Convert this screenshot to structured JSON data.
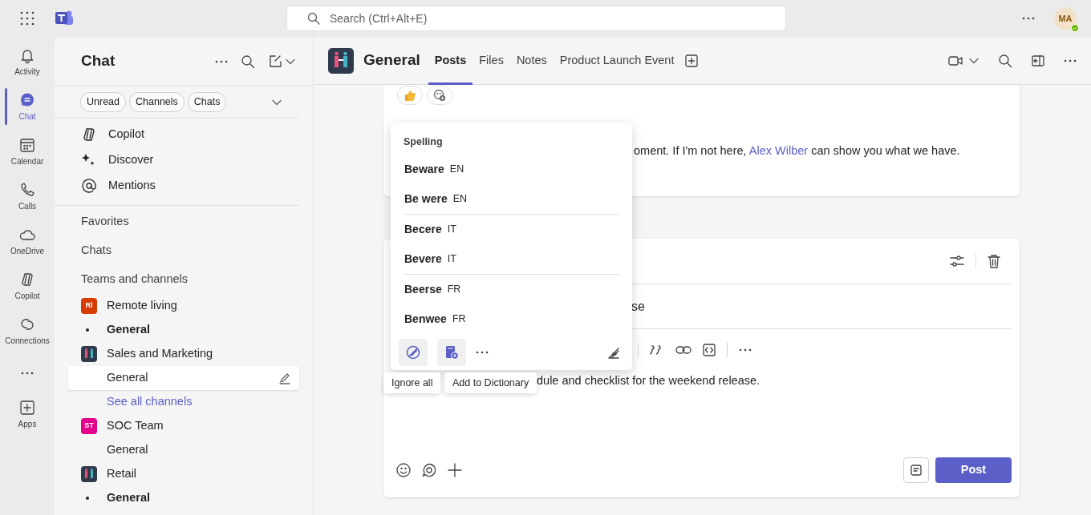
{
  "top_bar": {
    "search_placeholder": "Search (Ctrl+Alt+E)",
    "avatar_initials": "MA"
  },
  "rail": [
    {
      "label": "Activity",
      "selected": false
    },
    {
      "label": "Chat",
      "selected": true
    },
    {
      "label": "Calendar",
      "selected": false
    },
    {
      "label": "Calls",
      "selected": false
    },
    {
      "label": "OneDrive",
      "selected": false
    },
    {
      "label": "Copilot",
      "selected": false
    },
    {
      "label": "Connections",
      "selected": false
    }
  ],
  "rail_apps": {
    "label": "Apps"
  },
  "chat_panel": {
    "title": "Chat",
    "filters": [
      "Unread",
      "Channels",
      "Chats"
    ],
    "shortcuts": [
      "Copilot",
      "Discover",
      "Mentions"
    ],
    "sections": [
      "Favorites",
      "Chats",
      "Teams and channels"
    ],
    "teams": [
      {
        "name": "Remote living",
        "kind": "initials",
        "initials": "Rl",
        "color": "#d83b01",
        "channels": [
          {
            "name": "General",
            "unread": true,
            "selected": false
          }
        ]
      },
      {
        "name": "Sales and Marketing",
        "kind": "picture",
        "channels": [
          {
            "name": "General",
            "unread": false,
            "selected": true
          }
        ],
        "see_all": "See all channels"
      },
      {
        "name": "SOC Team",
        "kind": "initials",
        "initials": "ST",
        "color": "#e3008c",
        "channels": [
          {
            "name": "General",
            "unread": false,
            "selected": false
          }
        ]
      },
      {
        "name": "Retail",
        "kind": "picture",
        "channels": [
          {
            "name": "General",
            "unread": true,
            "selected": false
          }
        ]
      }
    ]
  },
  "channel_header": {
    "title": "General",
    "tabs": [
      {
        "label": "Posts",
        "selected": true
      },
      {
        "label": "Files",
        "selected": false
      },
      {
        "label": "Notes",
        "selected": false
      },
      {
        "label": "Product Launch Event",
        "selected": false
      }
    ]
  },
  "post": {
    "text_before": "oment. If I'm not here, ",
    "mention": "Alex Wilber",
    "text_after": " can show you what we have."
  },
  "compose": {
    "subject_fragment": "se",
    "body_fragment": "dule and checklist for the weekend release.",
    "send_label": "Post"
  },
  "spelling_menu": {
    "title": "Spelling",
    "groups": [
      {
        "suggestions": [
          {
            "word": "Beware",
            "lang": "EN"
          },
          {
            "word": "Be were",
            "lang": "EN"
          }
        ]
      },
      {
        "suggestions": [
          {
            "word": "Becere",
            "lang": "IT"
          },
          {
            "word": "Bevere",
            "lang": "IT"
          }
        ]
      },
      {
        "suggestions": [
          {
            "word": "Beerse",
            "lang": "FR"
          },
          {
            "word": "Benwee",
            "lang": "FR"
          }
        ]
      }
    ]
  },
  "tooltips": [
    "Ignore all",
    "Add to Dictionary"
  ]
}
